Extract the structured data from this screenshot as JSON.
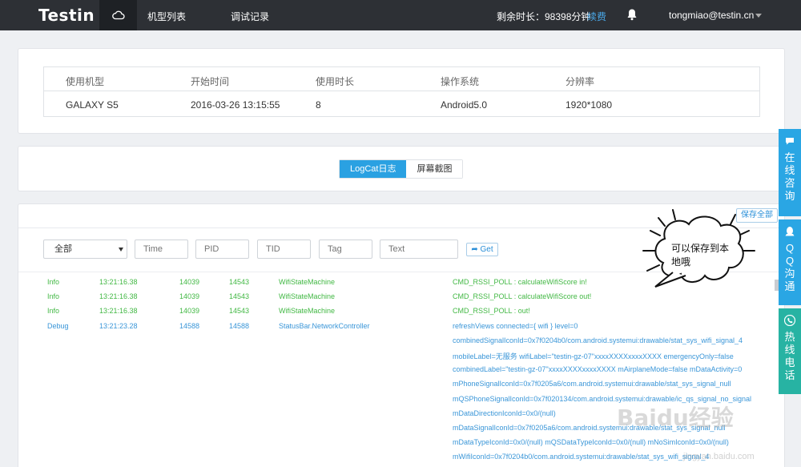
{
  "header": {
    "logo": "Testin",
    "nav": [
      "机型列表",
      "调试记录"
    ],
    "remaining": "剩余时长：98398分钟",
    "renew": "续费",
    "user": "tongmiao@testin.cn"
  },
  "info": {
    "columns": [
      "使用机型",
      "开始时间",
      "使用时长",
      "操作系统",
      "分辨率"
    ],
    "row": [
      "GALAXY S5",
      "2016-03-26 13:15:55",
      "8",
      "Android5.0",
      "1920*1080"
    ]
  },
  "tabs": [
    "LogCat日志",
    "屏幕截图"
  ],
  "log": {
    "save_all": "保存全部",
    "level_select": "全部",
    "placeholders": {
      "time": "Time",
      "pid": "PID",
      "tid": "TID",
      "tag": "Tag",
      "text": "Text"
    },
    "get": "Get",
    "rows": [
      {
        "level": "Info",
        "time": "13:21:16.38",
        "pid": "14039",
        "tid": "14543",
        "tag": "WifiStateMachine",
        "msg": "CMD_RSSI_POLL : calculateWifiScore in!"
      },
      {
        "level": "Info",
        "time": "13:21:16.38",
        "pid": "14039",
        "tid": "14543",
        "tag": "WifiStateMachine",
        "msg": "CMD_RSSI_POLL : calculateWifiScore out!"
      },
      {
        "level": "Info",
        "time": "13:21:16.38",
        "pid": "14039",
        "tid": "14543",
        "tag": "WifiStateMachine",
        "msg": "CMD_RSSI_POLL : out!"
      },
      {
        "level": "Debug",
        "time": "13:21:23.28",
        "pid": "14588",
        "tid": "14588",
        "tag": "StatusBar.NetworkController",
        "msg": "refreshViews connected={ wifi } level=0"
      },
      {
        "level": "",
        "time": "",
        "pid": "",
        "tid": "",
        "tag": "",
        "msg": "combinedSignalIconId=0x7f0204b0/com.android.systemui:drawable/stat_sys_wifi_signal_4"
      },
      {
        "level": "",
        "time": "",
        "pid": "",
        "tid": "",
        "tag": "",
        "msg": "mobileLabel=无服务 wifiLabel=\"testin-gz-07\"xxxxXXXXxxxxXXXX emergencyOnly=false"
      },
      {
        "level": "",
        "time": "",
        "pid": "",
        "tid": "",
        "tag": "",
        "msg": "combinedLabel=\"testin-gz-07\"xxxxXXXXxxxxXXXX mAirplaneMode=false mDataActivity=0"
      },
      {
        "level": "",
        "time": "",
        "pid": "",
        "tid": "",
        "tag": "",
        "msg": "mPhoneSignalIconId=0x7f0205a6/com.android.systemui:drawable/stat_sys_signal_null"
      },
      {
        "level": "",
        "time": "",
        "pid": "",
        "tid": "",
        "tag": "",
        "msg": "mQSPhoneSignalIconId=0x7f020134/com.android.systemui:drawable/ic_qs_signal_no_signal"
      },
      {
        "level": "",
        "time": "",
        "pid": "",
        "tid": "",
        "tag": "",
        "msg": "mDataDirectionIconId=0x0/(null)"
      },
      {
        "level": "",
        "time": "",
        "pid": "",
        "tid": "",
        "tag": "",
        "msg": "mDataSignalIconId=0x7f0205a6/com.android.systemui:drawable/stat_sys_signal_null"
      },
      {
        "level": "",
        "time": "",
        "pid": "",
        "tid": "",
        "tag": "",
        "msg": "mDataTypeIconId=0x0/(null) mQSDataTypeIconId=0x0/(null) mNoSimIconId=0x0/(null)"
      },
      {
        "level": "",
        "time": "",
        "pid": "",
        "tid": "",
        "tag": "",
        "msg": "mWifiIconId=0x7f0204b0/com.android.systemui:drawable/stat_sys_wifi_signal_4"
      }
    ]
  },
  "bubble": "可以保存到本地哦",
  "side": {
    "consult": "在线咨询",
    "qq": "QQ沟通",
    "hotline": "热线电话"
  },
  "watermark": {
    "main": "Baidu经验",
    "sub": "jingyan.baidu.com"
  },
  "colors": {
    "accent": "#2aa1e2",
    "info_text": "#42b844",
    "debug_text": "#3a96d8",
    "header_bg": "#2d3035"
  }
}
